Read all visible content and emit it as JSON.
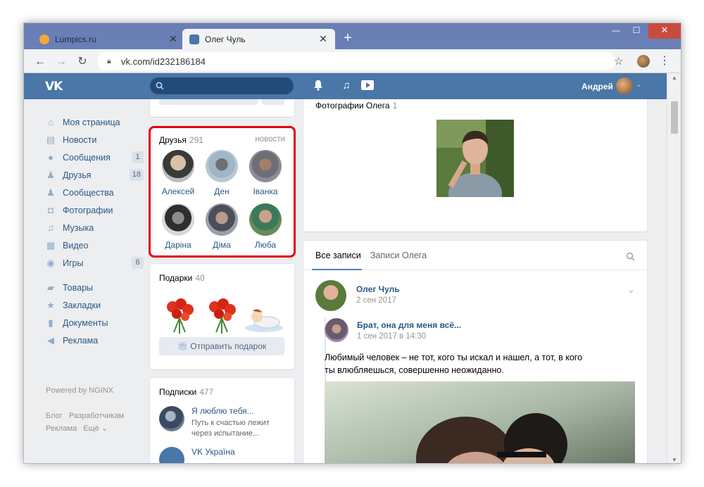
{
  "browser": {
    "tabs": [
      {
        "title": "Lumpics.ru",
        "active": false
      },
      {
        "title": "Олег Чуль",
        "active": true
      }
    ],
    "new_tab": "+",
    "close_glyph": "✕",
    "win_min": "—",
    "win_max": "☐",
    "win_close": "✕",
    "url": "vk.com/id232186184"
  },
  "vk": {
    "logo": "VK",
    "search_placeholder": "",
    "user_name": "Андрей",
    "accent": "#4a76a8"
  },
  "left_nav": {
    "items": [
      {
        "label": "Моя страница",
        "icon": "home-icon",
        "count": ""
      },
      {
        "label": "Новости",
        "icon": "news-icon",
        "count": ""
      },
      {
        "label": "Сообщения",
        "icon": "chat-icon",
        "count": "1"
      },
      {
        "label": "Друзья",
        "icon": "user-icon",
        "count": "18"
      },
      {
        "label": "Сообщества",
        "icon": "group-icon",
        "count": ""
      },
      {
        "label": "Фотографии",
        "icon": "camera-icon",
        "count": ""
      },
      {
        "label": "Музыка",
        "icon": "music-icon",
        "count": ""
      },
      {
        "label": "Видео",
        "icon": "film-icon",
        "count": ""
      },
      {
        "label": "Игры",
        "icon": "gamepad-icon",
        "count": "6"
      }
    ],
    "items2": [
      {
        "label": "Товары",
        "icon": "bag-icon"
      },
      {
        "label": "Закладки",
        "icon": "star-icon"
      },
      {
        "label": "Документы",
        "icon": "doc-icon"
      },
      {
        "label": "Реклама",
        "icon": "megaphone-icon"
      }
    ],
    "powered": "Powered by NGINX",
    "footer": {
      "blog": "Блог",
      "dev": "Разработчикам",
      "ads": "Реклама",
      "more": "Ещё ⌄"
    }
  },
  "friends": {
    "title": "Друзья",
    "count": "291",
    "news_link": "новости",
    "list": [
      {
        "name": "Алексей"
      },
      {
        "name": "Ден"
      },
      {
        "name": "Іванка"
      },
      {
        "name": "Даріна"
      },
      {
        "name": "Діма"
      },
      {
        "name": "Люба"
      }
    ]
  },
  "gifts": {
    "title": "Подарки",
    "count": "40",
    "send_button": "Отправить подарок"
  },
  "subscriptions": {
    "title": "Подписки",
    "count": "477",
    "items": [
      {
        "title": "Я люблю тебя...",
        "desc": "Путь к счастью лежит через испытание..."
      },
      {
        "title": "VK Україна",
        "desc": ""
      }
    ]
  },
  "photos": {
    "title": "Фотографии Олега",
    "count": "1"
  },
  "wall": {
    "tabs": [
      "Все записи",
      "Записи Олега"
    ],
    "post": {
      "author": "Олег Чуль",
      "date": "2 сен 2017",
      "repost_author": "Брат, она для меня всё...",
      "repost_date": "1 сен 2017 в 14:30",
      "text": "Любимый человек – не тот, кого ты искал и нашел, а тот, в кого ты влюбляешься, совершенно неожиданно."
    }
  }
}
